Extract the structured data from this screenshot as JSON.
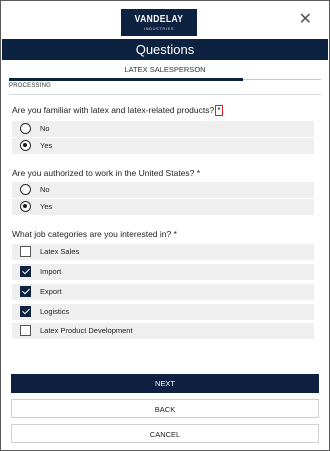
{
  "logo": {
    "brand": "VANDELAY",
    "subtitle": "INDUSTRIES"
  },
  "header": {
    "title": "Questions",
    "close_icon": "close-icon"
  },
  "job": {
    "title": "LATEX SALESPERSON"
  },
  "status": {
    "label": "PROCESSING",
    "progress": 0.75
  },
  "questions": [
    {
      "text": "Are you familiar with latex and latex-related products?",
      "required_mark": "*",
      "type": "radio",
      "options": [
        {
          "label": "No",
          "selected": false
        },
        {
          "label": "Yes",
          "selected": true
        }
      ]
    },
    {
      "text": "Are you authorized to work in the United States?",
      "required_mark": "*",
      "type": "radio",
      "options": [
        {
          "label": "No",
          "selected": false
        },
        {
          "label": "Yes",
          "selected": true
        }
      ]
    },
    {
      "text": "What job categories are you interested in?",
      "required_mark": "*",
      "type": "checkbox",
      "options": [
        {
          "label": "Latex Sales",
          "checked": false
        },
        {
          "label": "Import",
          "checked": true
        },
        {
          "label": "Export",
          "checked": true
        },
        {
          "label": "Logistics",
          "checked": true
        },
        {
          "label": "Latex Product Development",
          "checked": false
        }
      ]
    }
  ],
  "buttons": {
    "next": "NEXT",
    "back": "BACK",
    "cancel": "CANCEL"
  },
  "colors": {
    "navy": "#0d2240",
    "option_bg": "#efefef",
    "highlight": "#e02020"
  }
}
